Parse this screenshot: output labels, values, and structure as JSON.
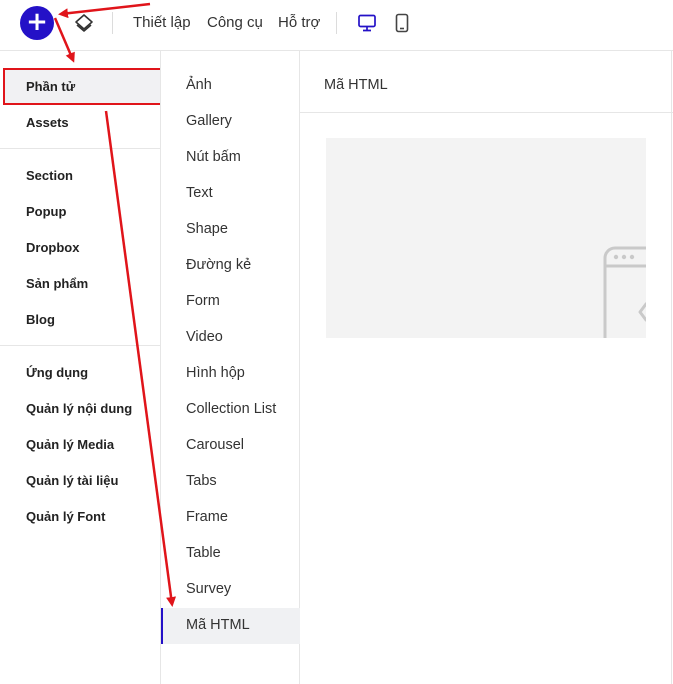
{
  "topbar": {
    "add_label": "+",
    "menu": [
      "Thiết lập",
      "Công cụ",
      "Hỗ trợ"
    ]
  },
  "sidebar": {
    "groups": [
      [
        "Phần tử",
        "Assets"
      ],
      [
        "Section",
        "Popup",
        "Dropbox",
        "Sản phẩm",
        "Blog"
      ],
      [
        "Ứng dụng",
        "Quản lý nội dung",
        "Quản lý Media",
        "Quản lý tài liệu",
        "Quản lý Font"
      ]
    ]
  },
  "elements": {
    "items": [
      "Ảnh",
      "Gallery",
      "Nút bấm",
      "Text",
      "Shape",
      "Đường kẻ",
      "Form",
      "Video",
      "Hình hộp",
      "Collection List",
      "Carousel",
      "Tabs",
      "Frame",
      "Table",
      "Survey",
      "Mã HTML"
    ]
  },
  "preview": {
    "title": "Mã HTML"
  },
  "colors": {
    "accent": "#2411c7",
    "annotation": "#e0141a"
  }
}
